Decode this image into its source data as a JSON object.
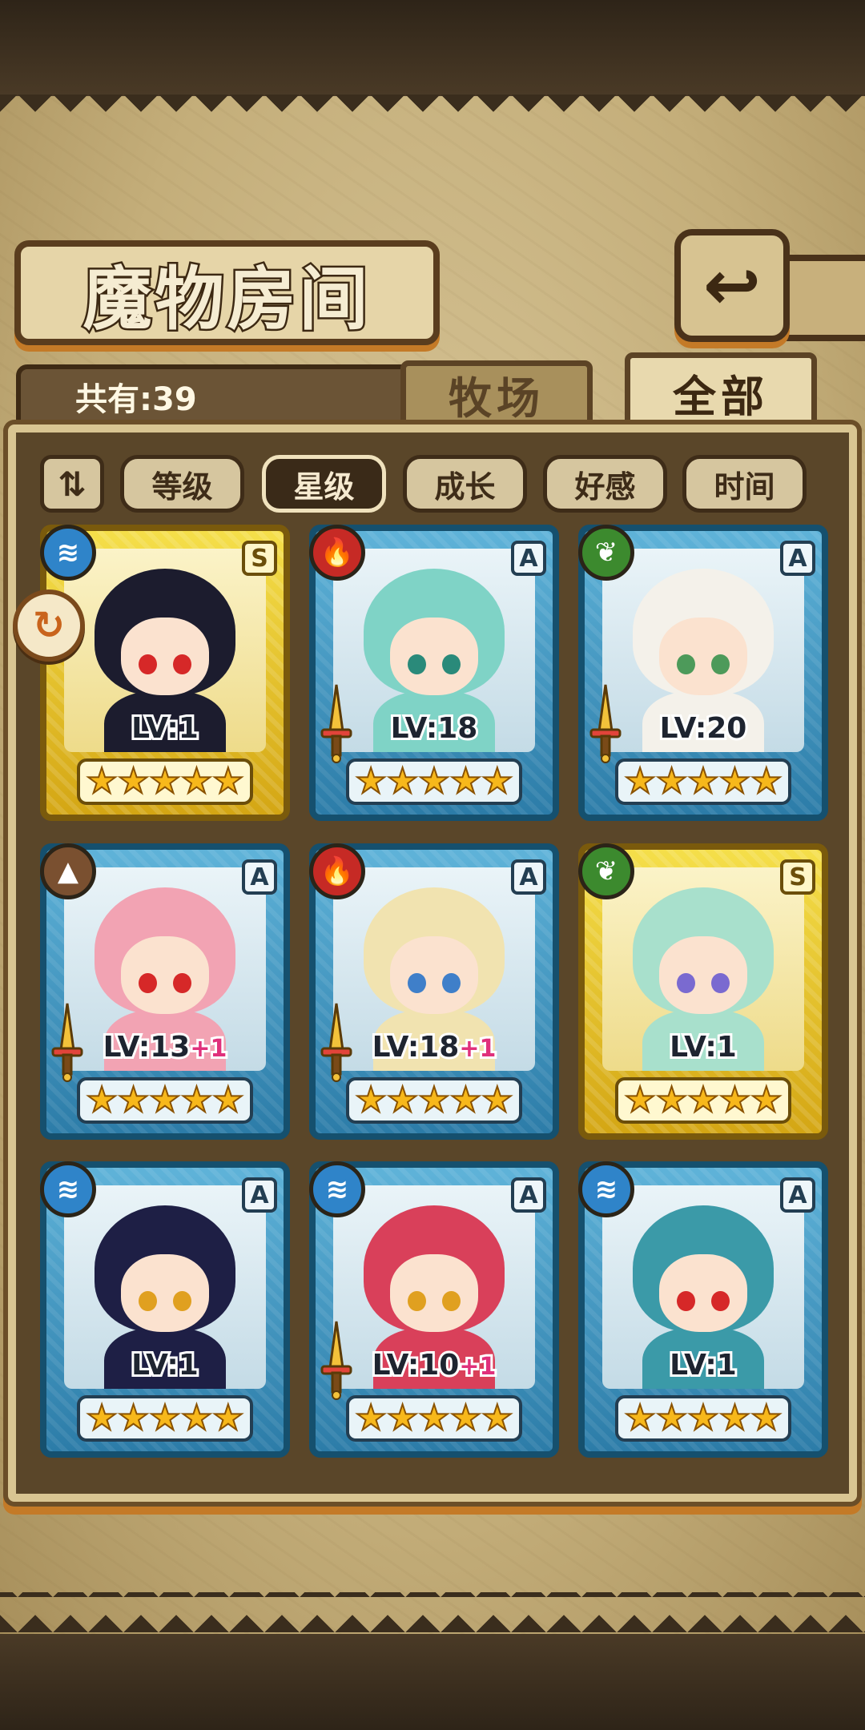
{
  "header": {
    "title": "魔物房间",
    "back_icon": "↩"
  },
  "count_label": "共有:39",
  "tabs": [
    {
      "label": "牧场",
      "active": false
    },
    {
      "label": "全部",
      "active": true
    }
  ],
  "sort": {
    "toggle_label": "⇅",
    "buttons": [
      {
        "label": "等级",
        "active": false
      },
      {
        "label": "星级",
        "active": true
      },
      {
        "label": "成长",
        "active": false
      },
      {
        "label": "好感",
        "active": false
      },
      {
        "label": "时间",
        "active": false
      }
    ]
  },
  "action_badge": "↻",
  "monsters": [
    {
      "element": "water",
      "rank": "S",
      "frame": "gold",
      "level": "LV:1",
      "bonus": "",
      "stars": 5,
      "hair": "#1c1c2e",
      "eyes": "#d62828",
      "sword": false
    },
    {
      "element": "fire",
      "rank": "A",
      "frame": "blue",
      "level": "LV:18",
      "bonus": "",
      "stars": 5,
      "hair": "#7fd3c6",
      "eyes": "#2a8a7a",
      "sword": true
    },
    {
      "element": "wood",
      "rank": "A",
      "frame": "blue",
      "level": "LV:20",
      "bonus": "",
      "stars": 5,
      "hair": "#f4f1ea",
      "eyes": "#4d9a5a",
      "sword": true
    },
    {
      "element": "earth",
      "rank": "A",
      "frame": "blue",
      "level": "LV:13",
      "bonus": "+1",
      "stars": 5,
      "hair": "#f2a3b3",
      "eyes": "#d62828",
      "sword": true
    },
    {
      "element": "fire",
      "rank": "A",
      "frame": "blue",
      "level": "LV:18",
      "bonus": "+1",
      "stars": 5,
      "hair": "#f1e3b0",
      "eyes": "#3f7fc9",
      "sword": true
    },
    {
      "element": "wood",
      "rank": "S",
      "frame": "gold",
      "level": "LV:1",
      "bonus": "",
      "stars": 5,
      "hair": "#a8e0cc",
      "eyes": "#7a6ad0",
      "sword": false
    },
    {
      "element": "water",
      "rank": "A",
      "frame": "blue",
      "level": "LV:1",
      "bonus": "",
      "stars": 5,
      "hair": "#1e1f45",
      "eyes": "#e0a020",
      "sword": false
    },
    {
      "element": "water",
      "rank": "A",
      "frame": "blue",
      "level": "LV:10",
      "bonus": "+1",
      "stars": 5,
      "hair": "#d9405a",
      "eyes": "#e0a020",
      "sword": true
    },
    {
      "element": "water",
      "rank": "A",
      "frame": "blue",
      "level": "LV:1",
      "bonus": "",
      "stars": 5,
      "hair": "#3b9aa8",
      "eyes": "#d62828",
      "sword": false
    }
  ],
  "element_icons": {
    "water": "≋",
    "fire": "🔥",
    "wood": "❦",
    "earth": "▲"
  }
}
